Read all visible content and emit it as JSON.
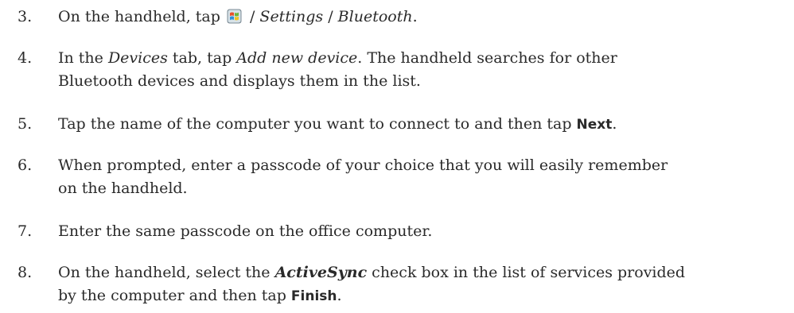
{
  "steps": [
    {
      "number": "3.",
      "lines": [
        {
          "a": "On the handheld, tap ",
          "icon": "windows-start-icon",
          "sep1": " / ",
          "b": "Settings",
          "sep2": " / ",
          "c": "Bluetooth",
          "end": "."
        }
      ]
    },
    {
      "number": "4.",
      "lines": [
        {
          "a": "In the ",
          "b": "Devices",
          "c": " tab, tap ",
          "d": "Add new device",
          "e": ". The handheld searches for other"
        },
        {
          "a": "Bluetooth devices and displays them in the list."
        }
      ]
    },
    {
      "number": "5.",
      "lines": [
        {
          "a": "Tap the name of the computer you want to connect to and then tap ",
          "b": "Next",
          "c": "."
        }
      ]
    },
    {
      "number": "6.",
      "lines": [
        {
          "a": "When prompted, enter a passcode of your choice that you will easily remember"
        },
        {
          "a": "on the handheld."
        }
      ]
    },
    {
      "number": "7.",
      "lines": [
        {
          "a": "Enter the same passcode on the office computer."
        }
      ]
    },
    {
      "number": "8.",
      "lines": [
        {
          "a": "On the handheld, select the ",
          "b": "ActiveSync",
          "c": " check box in the list of services provided"
        },
        {
          "a": "by the computer and then tap ",
          "b": "Finish",
          "c": "."
        }
      ]
    }
  ],
  "colors": {
    "text": "#2a2a2a",
    "icon_red": "#e8512a",
    "icon_green": "#6cb83a",
    "icon_blue": "#2f8fd8",
    "icon_yellow": "#f2c320"
  }
}
